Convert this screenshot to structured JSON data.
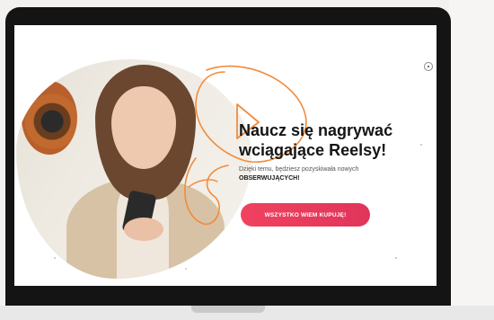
{
  "hero": {
    "headline_line1": "Naucz się nagrywać",
    "headline_line2": "wciągające Reelsy!",
    "subtext": "Dzięki temu, będziesz pozyskiwała nowych",
    "subtext_bold": "OBSERWUJĄCYCH!",
    "cta_label": "WSZYSTKO WIEM KUPUJĘ!"
  },
  "colors": {
    "cta": "#f0425f",
    "doodle": "#f28b3a",
    "headline": "#151515",
    "frame": "#141414"
  },
  "icons": {
    "play": "play-doodle-icon",
    "side_dot": "radio-dot-icon"
  }
}
